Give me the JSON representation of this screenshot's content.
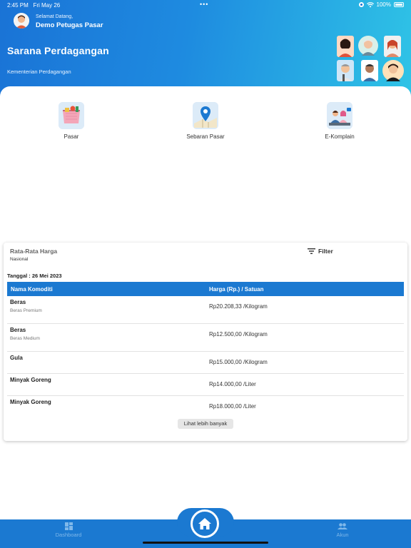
{
  "status_bar": {
    "time": "2:45 PM",
    "date": "Fri May 26",
    "dots": "•••",
    "battery": "100%"
  },
  "header": {
    "greeting": "Selamat Datang,",
    "user_name": "Demo Petugas Pasar",
    "title": "Sarana Perdagangan",
    "subtitle": "Kementerian Perdagangan"
  },
  "menu": [
    {
      "label": "Pasar",
      "icon": "market-basket-icon"
    },
    {
      "label": "Sebaran Pasar",
      "icon": "map-pin-icon"
    },
    {
      "label": "E-Komplain",
      "icon": "complaint-desk-icon"
    }
  ],
  "price_card": {
    "title": "Rata-Rata Harga",
    "subtitle": "Nasional",
    "filter_label": "Filter",
    "date": "Tanggal : 26 Mei 2023",
    "columns": [
      "Nama Komoditi",
      "Harga (Rp.) / Satuan"
    ],
    "rows": [
      {
        "name": "Beras",
        "sub": "Beras Premium",
        "price": "Rp20.208,33 /Kilogram"
      },
      {
        "name": "Beras",
        "sub": "Beras Medium",
        "price": "Rp12.500,00 /Kilogram"
      },
      {
        "name": "Gula",
        "sub": "",
        "price": "Rp15.000,00 /Kilogram"
      },
      {
        "name": "Minyak Goreng",
        "sub": "",
        "price": "Rp14.000,00 /Liter"
      },
      {
        "name": "Minyak Goreng",
        "sub": "",
        "price": "Rp18.000,00 /Liter"
      }
    ],
    "more_label": "Lihat lebih banyak"
  },
  "bottom_nav": {
    "dashboard_label": "Dashboard",
    "account_label": "Akun",
    "home_icon": "home-icon"
  },
  "colors": {
    "primary": "#1b79d1",
    "header_start": "#1a73d6",
    "header_end": "#2fc4e6"
  }
}
